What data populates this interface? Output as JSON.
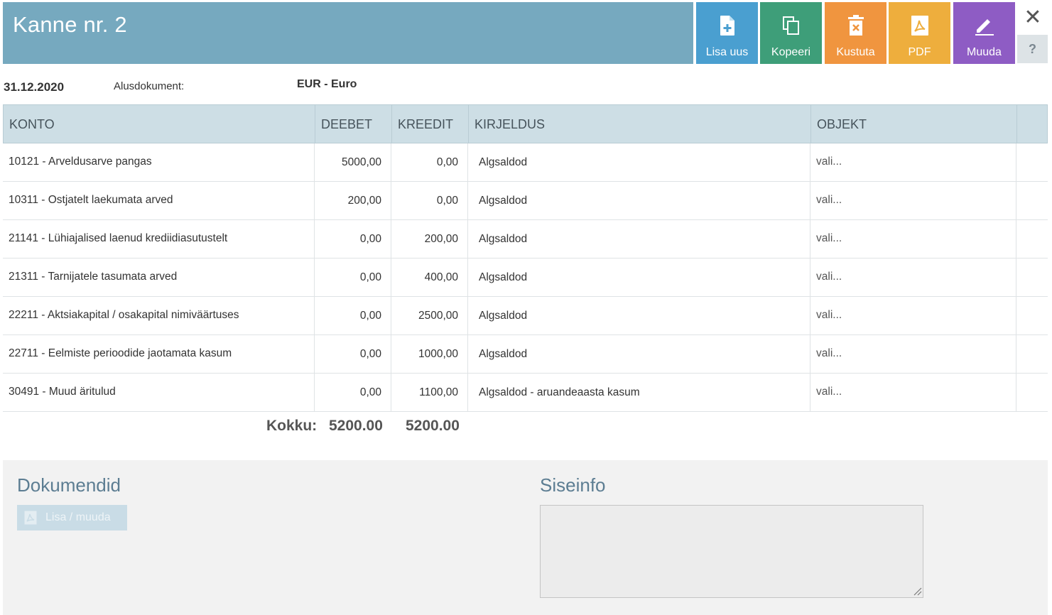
{
  "header": {
    "title": "Kanne nr. 2",
    "colors": {
      "title_bg": "#76a9bf"
    }
  },
  "actions": [
    {
      "id": "add",
      "label": "Lisa uus",
      "icon": "file-plus-icon",
      "color": "#4a9fd0"
    },
    {
      "id": "copy",
      "label": "Kopeeri",
      "icon": "copy-icon",
      "color": "#3e9e79"
    },
    {
      "id": "delete",
      "label": "Kustuta",
      "icon": "trash-icon",
      "color": "#f0953f"
    },
    {
      "id": "pdf",
      "label": "PDF",
      "icon": "pdf-icon",
      "color": "#eeae3d"
    },
    {
      "id": "edit",
      "label": "Muuda",
      "icon": "pencil-icon",
      "color": "#8e5cc4"
    }
  ],
  "window": {
    "close_icon": "close-icon",
    "help_label": "?"
  },
  "meta": {
    "date": "31.12.2020",
    "document_label": "Alusdokument:",
    "currency": "EUR - Euro"
  },
  "table": {
    "headers": [
      "KONTO",
      "DEEBET",
      "KREEDIT",
      "KIRJELDUS",
      "OBJEKT"
    ],
    "rows": [
      {
        "konto": "10121 - Arveldusarve pangas",
        "deebet": "5000,00",
        "kreedit": "0,00",
        "kirjeldus": "Algsaldod",
        "objekt": "vali..."
      },
      {
        "konto": "10311 - Ostjatelt laekumata arved",
        "deebet": "200,00",
        "kreedit": "0,00",
        "kirjeldus": "Algsaldod",
        "objekt": "vali..."
      },
      {
        "konto": "21141 - Lühiajalised laenud krediidiasutustelt",
        "deebet": "0,00",
        "kreedit": "200,00",
        "kirjeldus": "Algsaldod",
        "objekt": "vali..."
      },
      {
        "konto": "21311 - Tarnijatele tasumata arved",
        "deebet": "0,00",
        "kreedit": "400,00",
        "kirjeldus": "Algsaldod",
        "objekt": "vali..."
      },
      {
        "konto": "22211 - Aktsiakapital / osakapital nimiväärtuses",
        "deebet": "0,00",
        "kreedit": "2500,00",
        "kirjeldus": "Algsaldod",
        "objekt": "vali..."
      },
      {
        "konto": "22711 - Eelmiste perioodide jaotamata kasum",
        "deebet": "0,00",
        "kreedit": "1000,00",
        "kirjeldus": "Algsaldod",
        "objekt": "vali..."
      },
      {
        "konto": "30491 - Muud äritulud",
        "deebet": "0,00",
        "kreedit": "1100,00",
        "kirjeldus": "Algsaldod - aruandeaasta kasum",
        "objekt": "vali..."
      }
    ]
  },
  "totals": {
    "label": "Kokku:",
    "deebet": "5200.00",
    "kreedit": "5200.00"
  },
  "documents": {
    "title": "Dokumendid",
    "button_label": "Lisa / muuda",
    "button_icon": "pdf-icon"
  },
  "internal": {
    "title": "Siseinfo",
    "value": ""
  }
}
